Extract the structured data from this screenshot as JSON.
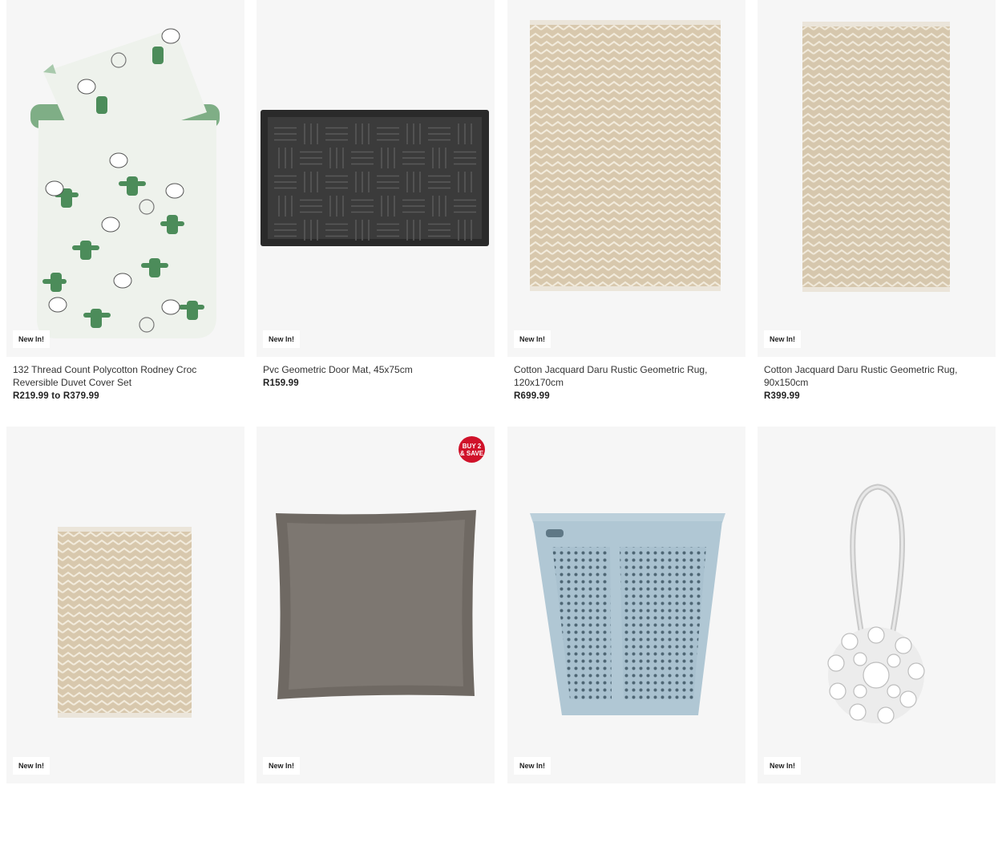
{
  "badges": {
    "new": "New In!",
    "promo_line1": "BUY 2",
    "promo_line2": "& SAVE"
  },
  "products": [
    {
      "title": "132 Thread Count Polycotton Rodney Croc Reversible Duvet Cover Set",
      "price": "R219.99 to R379.99",
      "badge": "New In!",
      "image": "duvet-cover-set"
    },
    {
      "title": "Pvc Geometric Door Mat, 45x75cm",
      "price": "R159.99",
      "badge": "New In!",
      "image": "door-mat"
    },
    {
      "title": "Cotton Jacquard Daru Rustic Geometric Rug, 120x170cm",
      "price": "R699.99",
      "badge": "New In!",
      "image": "rug"
    },
    {
      "title": "Cotton Jacquard Daru Rustic Geometric Rug, 90x150cm",
      "price": "R399.99",
      "badge": "New In!",
      "image": "rug"
    },
    {
      "badge": "New In!",
      "image": "rug-small"
    },
    {
      "badge": "New In!",
      "image": "cushion",
      "promo": "BUY 2 & SAVE"
    },
    {
      "badge": "New In!",
      "image": "laundry-basket"
    },
    {
      "badge": "New In!",
      "image": "curtain-tieback"
    }
  ],
  "colors": {
    "card_background": "#f6f6f6",
    "promo_badge": "#d0122a",
    "text": "#222222"
  }
}
